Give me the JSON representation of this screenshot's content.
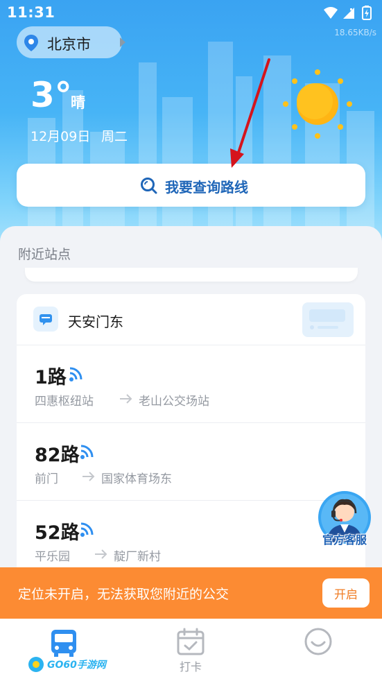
{
  "status_bar": {
    "time": "11:31",
    "speed": "18.65KB/s",
    "icons": [
      "wifi-icon",
      "signal-icon",
      "battery-icon"
    ]
  },
  "location": {
    "city": "北京市"
  },
  "weather": {
    "temperature": "3°",
    "condition": "晴",
    "date": "12月09日",
    "weekday": "周二",
    "icon": "sun-icon"
  },
  "search": {
    "label": "我要查询路线"
  },
  "nearby": {
    "section_title": "附近站点",
    "station": {
      "name": "天安门东",
      "routes": [
        {
          "name": "1路",
          "from": "四惠枢纽站",
          "to": "老山公交场站"
        },
        {
          "name": "82路",
          "from": "前门",
          "to": "国家体育场东"
        },
        {
          "name": "52路",
          "from": "平乐园",
          "to": "靛厂新村"
        }
      ]
    }
  },
  "customer_service": {
    "label": "官方客服"
  },
  "notice": {
    "text": "定位未开启，无法获取您附近的公交",
    "button": "开启"
  },
  "bottom_nav": {
    "items": [
      {
        "label": "",
        "icon": "bus-icon",
        "active": true
      },
      {
        "label": "打卡",
        "icon": "calendar-check-icon",
        "active": false
      },
      {
        "label": "",
        "icon": "profile-icon",
        "active": false
      }
    ],
    "watermark": "GO60手游网"
  },
  "colors": {
    "sky_top": "#3aa3f2",
    "accent_blue": "#1f66b8",
    "notice_orange": "#fc8b33",
    "active_nav": "#2f8ff0"
  }
}
